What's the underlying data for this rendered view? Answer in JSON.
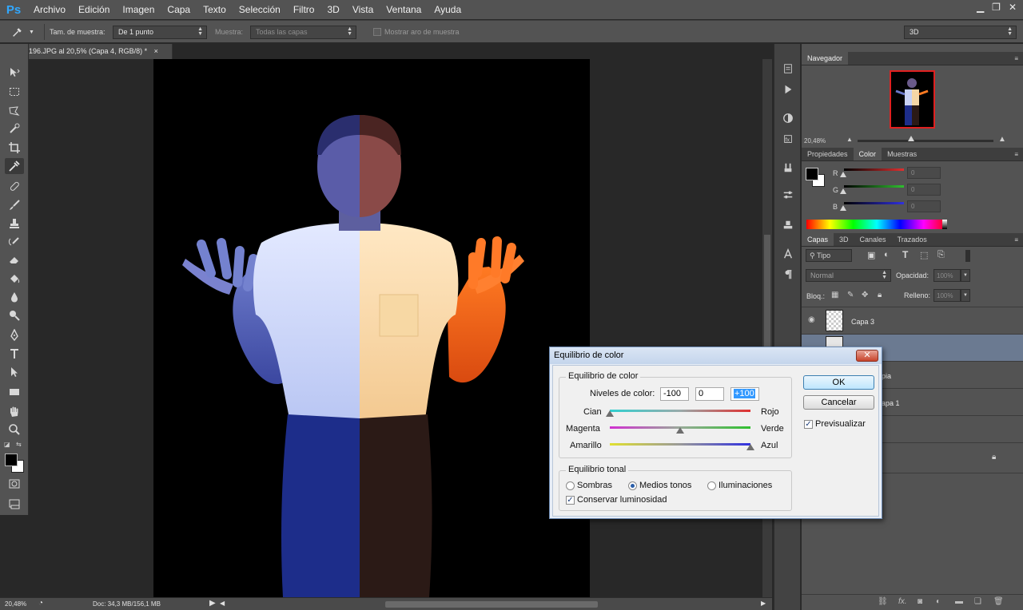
{
  "app": {
    "logo": "Ps"
  },
  "menu": [
    "Archivo",
    "Edición",
    "Imagen",
    "Capa",
    "Texto",
    "Selección",
    "Filtro",
    "3D",
    "Vista",
    "Ventana",
    "Ayuda"
  ],
  "window_controls": {
    "minimize": "▁",
    "restore": "❐",
    "close": "✕"
  },
  "options": {
    "sample_size_label": "Tam. de muestra:",
    "sample_size_value": "De 1 punto",
    "sample_label": "Muestra:",
    "sample_value": "Todas las capas",
    "show_ring_label": "Mostrar aro de muestra",
    "workspace": "3D"
  },
  "document": {
    "tab_title": "196.JPG al 20,5% (Capa 4, RGB/8) *",
    "tab_close": "×"
  },
  "status": {
    "zoom": "20,48%",
    "doc": "Doc: 34,3 MB/156,1 MB"
  },
  "navigator": {
    "tab": "Navegador",
    "zoom": "20,48%"
  },
  "color_panel": {
    "tabs": [
      "Propiedades",
      "Color",
      "Muestras"
    ],
    "active_tab": "Color",
    "channels": [
      {
        "label": "R",
        "value": "0",
        "color": "#e03030"
      },
      {
        "label": "G",
        "value": "0",
        "color": "#30c030"
      },
      {
        "label": "B",
        "value": "0",
        "color": "#3030e0"
      }
    ]
  },
  "layers_panel": {
    "tabs": [
      "Capas",
      "3D",
      "Canales",
      "Trazados"
    ],
    "filter": "Tipo",
    "blend_mode": "Normal",
    "opacity_label": "Opacidad:",
    "opacity_value": "100%",
    "lock_label": "Bloq.:",
    "fill_label": "Relleno:",
    "fill_value": "100%",
    "layers": [
      {
        "name": "Capa 3",
        "visible": true,
        "selected": false
      },
      {
        "name": "",
        "visible": false,
        "selected": true
      },
      {
        "name": "pia",
        "visible": false,
        "selected": false
      },
      {
        "name": "apa 1",
        "visible": false,
        "selected": false
      },
      {
        "name": "",
        "visible": false,
        "selected": false
      },
      {
        "name": "",
        "visible": false,
        "selected": false,
        "locked": true
      }
    ]
  },
  "dialog": {
    "title": "Equilibrio de color",
    "close": "✕",
    "group_balance": "Equilibrio de color",
    "levels_label": "Niveles de color:",
    "levels": [
      "-100",
      "0",
      "+100"
    ],
    "sliders": [
      {
        "left": "Cian",
        "right": "Rojo",
        "value": -100
      },
      {
        "left": "Magenta",
        "right": "Verde",
        "value": 0
      },
      {
        "left": "Amarillo",
        "right": "Azul",
        "value": 100
      }
    ],
    "group_tone": "Equilibrio tonal",
    "tones": [
      "Sombras",
      "Medios tonos",
      "Iluminaciones"
    ],
    "selected_tone": "Medios tonos",
    "preserve_luminosity": "Conservar luminosidad",
    "ok": "OK",
    "cancel": "Cancelar",
    "preview": "Previsualizar"
  }
}
